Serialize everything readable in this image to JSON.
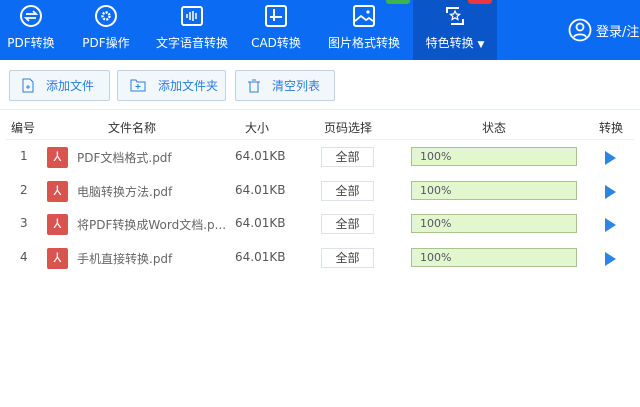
{
  "nav": [
    {
      "label": "PDF转换",
      "icon": "pdf-convert-icon"
    },
    {
      "label": "PDF操作",
      "icon": "pdf-operate-icon"
    },
    {
      "label": "文字语音转换",
      "icon": "voice-icon"
    },
    {
      "label": "CAD转换",
      "icon": "cad-icon"
    },
    {
      "label": "图片格式转换",
      "icon": "image-icon"
    },
    {
      "label": "特色转换",
      "icon": "star-convert-icon",
      "active": true
    }
  ],
  "login": "登录/注",
  "toolbar": {
    "add_file": "添加文件",
    "add_folder": "添加文件夹",
    "clear": "清空列表"
  },
  "table": {
    "headers": [
      "编号",
      "文件名称",
      "大小",
      "页码选择",
      "状态",
      "转换"
    ],
    "rows": [
      {
        "no": "1",
        "name": "PDF文档格式.pdf",
        "size": "64.01KB",
        "pages": "全部",
        "status": "100%",
        "progress": 100
      },
      {
        "no": "2",
        "name": "电脑转换方法.pdf",
        "size": "64.01KB",
        "pages": "全部",
        "status": "100%",
        "progress": 100
      },
      {
        "no": "3",
        "name": "将PDF转换成Word文档.p...",
        "size": "64.01KB",
        "pages": "全部",
        "status": "100%",
        "progress": 100
      },
      {
        "no": "4",
        "name": "手机直接转换.pdf",
        "size": "64.01KB",
        "pages": "全部",
        "status": "100%",
        "progress": 100
      }
    ]
  },
  "colors": {
    "header": "#0b6cf3",
    "active_tab": "#0a56c8",
    "progress": "#e3f7cf",
    "play": "#2a86e5"
  }
}
